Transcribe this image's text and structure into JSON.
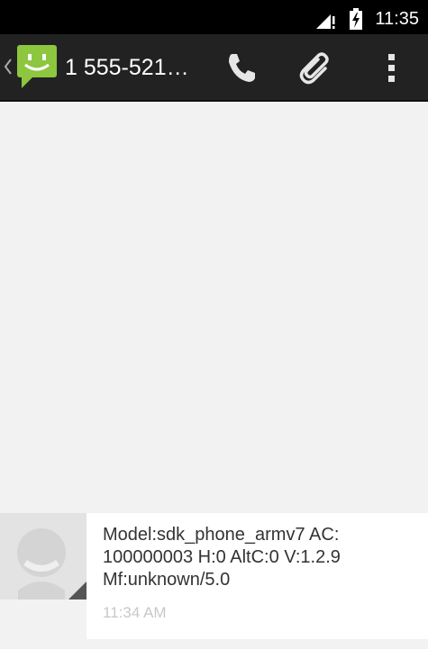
{
  "status_bar": {
    "time": "11:35",
    "icons": [
      "signal-icon",
      "battery-charging-icon"
    ]
  },
  "action_bar": {
    "title": "1 555-521…",
    "icons": [
      "up-caret-icon",
      "messaging-app-icon",
      "phone-icon",
      "paperclip-icon",
      "overflow-menu-icon"
    ],
    "app_icon_color": "#8dc63f"
  },
  "conversation": {
    "messages": [
      {
        "text": "Model:sdk_phone_armv7 AC:\n100000003 H:0 AltC:0 V:1.2.9\nMf:unknown/5.0",
        "time": "11:34 AM"
      }
    ]
  }
}
